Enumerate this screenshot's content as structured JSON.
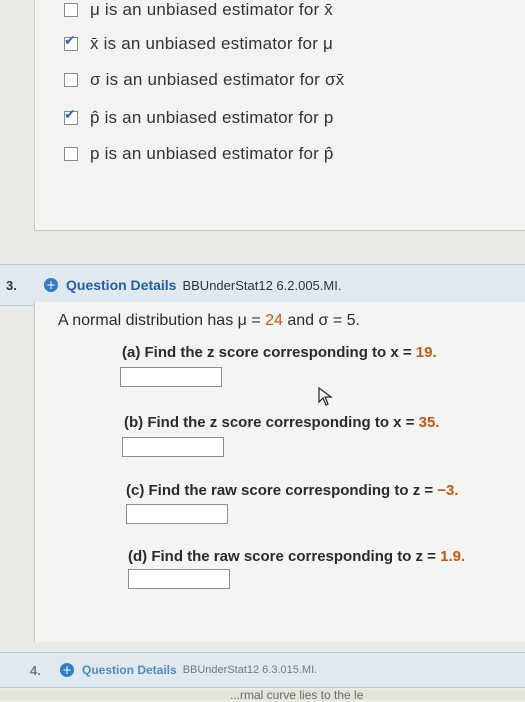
{
  "options": [
    {
      "label": "μ is an unbiased estimator for x̄",
      "checked": false
    },
    {
      "label": "x̄ is an unbiased estimator for μ",
      "checked": true
    },
    {
      "label": "σ is an unbiased estimator for σx̄",
      "checked": false
    },
    {
      "label": "p̂ is an unbiased estimator for p",
      "checked": true
    },
    {
      "label": "p is an unbiased estimator for p̂",
      "checked": false
    }
  ],
  "question3": {
    "number": "3.",
    "details_label": "Question Details",
    "code": "BBUnderStat12 6.2.005.MI.",
    "stem_prefix": "A normal distribution has μ = ",
    "mu": "24",
    "stem_mid": " and σ = ",
    "sigma": "5.",
    "parts": [
      {
        "prefix": "(a) Find the z score corresponding to x = ",
        "value": "19."
      },
      {
        "prefix": "(b) Find the z score corresponding to x = ",
        "value": "35."
      },
      {
        "prefix": "(c) Find the raw score corresponding to z = ",
        "value": "−3."
      },
      {
        "prefix": "(d) Find the raw score corresponding to z = ",
        "value": "1.9."
      }
    ]
  },
  "question4": {
    "number": "4.",
    "details_label": "Question Details",
    "code": "BBUnderStat12 6.3.015.MI."
  },
  "bottom_text": "...rmal curve lies to the le",
  "colors": {
    "accent": "#1f5fa3",
    "value": "#c05a12",
    "bar": "#dfe9ef"
  }
}
